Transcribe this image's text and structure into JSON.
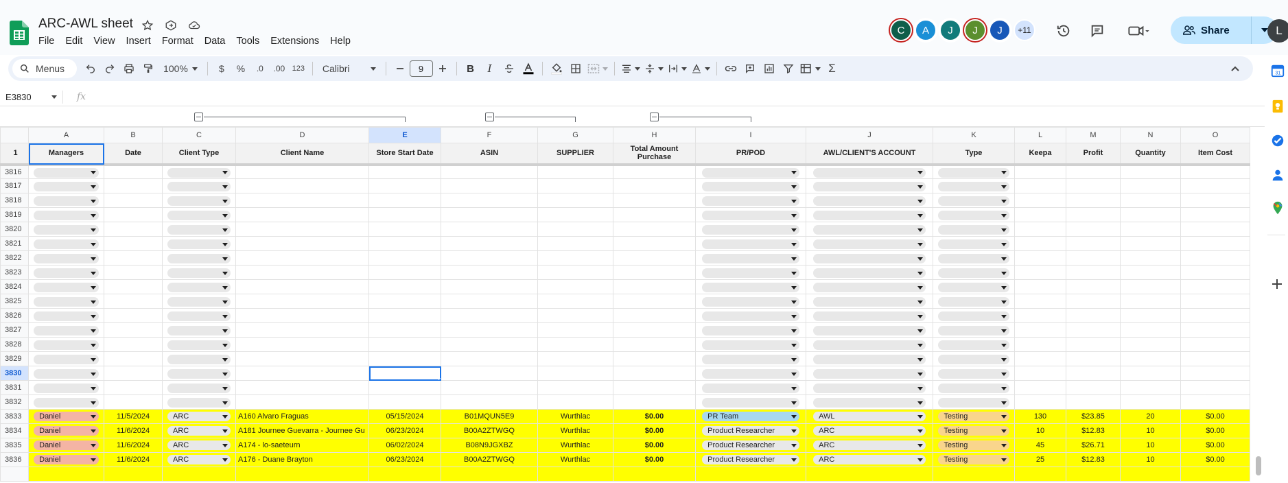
{
  "app": {
    "title": "ARC-AWL sheet",
    "menu": [
      "File",
      "Edit",
      "View",
      "Insert",
      "Format",
      "Data",
      "Tools",
      "Extensions",
      "Help"
    ]
  },
  "collaborators": [
    {
      "initial": "C",
      "color": "#0f5e4a",
      "ring": "#c5221f"
    },
    {
      "initial": "A",
      "color": "#1a8fd6",
      "ring": "#ffffff"
    },
    {
      "initial": "J",
      "color": "#127b7a",
      "ring": "#ffffff"
    },
    {
      "initial": "J",
      "color": "#5b8f2e",
      "ring": "#c5221f"
    },
    {
      "initial": "J",
      "color": "#1858b8",
      "ring": "#ffffff"
    }
  ],
  "collab_more": "+11",
  "share_label": "Share",
  "user_initial": "L",
  "toolbar": {
    "menus_label": "Menus",
    "zoom": "100%",
    "currency": "$",
    "percent": "%",
    "dec_decrease": ".0",
    "dec_increase": ".00",
    "number_format": "123",
    "font": "Calibri",
    "font_size": "9"
  },
  "formula_bar": {
    "cell_ref": "E3830",
    "fx": "fx",
    "value": ""
  },
  "columns": [
    "A",
    "B",
    "C",
    "D",
    "E",
    "F",
    "G",
    "H",
    "I",
    "J",
    "K",
    "L",
    "M",
    "N",
    "O"
  ],
  "selected_column": "E",
  "header_row": {
    "number": "1",
    "cells": [
      "Managers",
      "Date",
      "Client Type",
      "Client Name",
      "Store Start Date",
      "ASIN",
      "SUPPLIER",
      "Total Amount Purchase",
      "PR/POD",
      "AWL/CLIENT'S ACCOUNT",
      "Type",
      "Keepa",
      "Profit",
      "Quantity",
      "Item Cost"
    ]
  },
  "empty_rows": [
    "3816",
    "3817",
    "3818",
    "3819",
    "3820",
    "3821",
    "3822",
    "3823",
    "3824",
    "3825",
    "3826",
    "3827",
    "3828",
    "3829",
    "3830",
    "3831",
    "3832"
  ],
  "selected_row": "3830",
  "data_rows": [
    {
      "num": "3833",
      "manager": "Daniel",
      "date": "11/5/2024",
      "client_type": "ARC",
      "client_name": "A160 Alvaro Fraguas",
      "store_start": "05/15/2024",
      "asin": "B01MQUN5E9",
      "supplier": "Wurthlac",
      "total": "$0.00",
      "pr_pod": "PR Team",
      "account": "AWL",
      "type": "Testing",
      "keepa": "130",
      "profit": "$23.85",
      "quantity": "20",
      "item_cost": "$0.00"
    },
    {
      "num": "3834",
      "manager": "Daniel",
      "date": "11/6/2024",
      "client_type": "ARC",
      "client_name": "A181 Journee Guevarra - Journee Gu",
      "store_start": "06/23/2024",
      "asin": "B00A2ZTWGQ",
      "supplier": "Wurthlac",
      "total": "$0.00",
      "pr_pod": "Product Researcher",
      "account": "ARC",
      "type": "Testing",
      "keepa": "10",
      "profit": "$12.83",
      "quantity": "10",
      "item_cost": "$0.00"
    },
    {
      "num": "3835",
      "manager": "Daniel",
      "date": "11/6/2024",
      "client_type": "ARC",
      "client_name": "A174 - lo-saeteurn",
      "store_start": "06/02/2024",
      "asin": "B08N9JGXBZ",
      "supplier": "Wurthlac",
      "total": "$0.00",
      "pr_pod": "Product Researcher",
      "account": "ARC",
      "type": "Testing",
      "keepa": "45",
      "profit": "$26.71",
      "quantity": "10",
      "item_cost": "$0.00"
    },
    {
      "num": "3836",
      "manager": "Daniel",
      "date": "11/6/2024",
      "client_type": "ARC",
      "client_name": "A176 - Duane Brayton",
      "store_start": "06/23/2024",
      "asin": "B00A2ZTWGQ",
      "supplier": "Wurthlac",
      "total": "$0.00",
      "pr_pod": "Product Researcher",
      "account": "ARC",
      "type": "Testing",
      "keepa": "25",
      "profit": "$12.83",
      "quantity": "10",
      "item_cost": "$0.00"
    }
  ],
  "colors": {
    "accent": "#1a73e8",
    "highlight": "#ffff00",
    "share_bg": "#c2e7ff"
  }
}
